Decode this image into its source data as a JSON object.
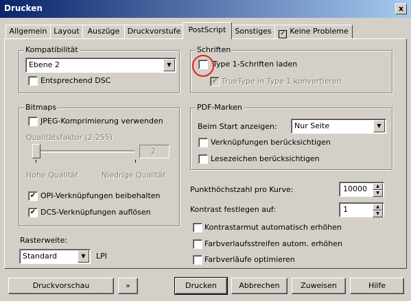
{
  "window": {
    "title": "Drucken",
    "close_label": "x"
  },
  "tabs": [
    {
      "label": "Allgemein"
    },
    {
      "label": "Layout"
    },
    {
      "label": "Auszüge"
    },
    {
      "label": "Druckvorstufe"
    },
    {
      "label": "PostScript",
      "active": true
    },
    {
      "label": "Sonstiges"
    },
    {
      "label": "Keine Probleme"
    }
  ],
  "compat": {
    "legend": "Kompatibilität",
    "level": "Ebene 2",
    "dsc_label": "Entsprechend DSC",
    "dsc_checked": false
  },
  "bitmaps": {
    "legend": "Bitmaps",
    "jpeg_label": "JPEG-Komprimierung verwenden",
    "jpeg_checked": false,
    "quality_label": "Qualitätsfaktor (2-255)",
    "quality_value": "2",
    "high_quality": "Hohe Qualität",
    "low_quality": "Niedrige Qualität",
    "opi_label": "OPI-Verknüpfungen beibehalten",
    "opi_checked": true,
    "dcs_label": "DCS-Verknüpfungen auflösen",
    "dcs_checked": true
  },
  "raster": {
    "label": "Rasterweite:",
    "value": "Standard",
    "unit": "LPI"
  },
  "fonts": {
    "legend": "Schriften",
    "type1_label": "Type 1-Schriften laden",
    "type1_checked": false,
    "truetype_label": "TrueType in Type 1 konvertieren",
    "truetype_checked": true
  },
  "pdf": {
    "legend": "PDF-Marken",
    "start_label": "Beim Start anzeigen:",
    "start_value": "Nur Seite",
    "links_label": "Verknüpfungen berücksichtigen",
    "bookmarks_label": "Lesezeichen berücksichtigen"
  },
  "curve": {
    "label": "Punkthöchstzahl pro Kurve:",
    "value": "10000"
  },
  "contrast": {
    "label": "Kontrast festlegen auf:",
    "value": "1"
  },
  "options": {
    "contrast_auto": "Kontrastarmut automatisch erhöhen",
    "gradient_strips": "Farbverlaufsstreifen autom. erhöhen",
    "gradient_opt": "Farbverläufe optimieren"
  },
  "buttons": {
    "preview": "Druckvorschau",
    "expand": "»",
    "print": "Drucken",
    "cancel": "Abbrechen",
    "assign": "Zuweisen",
    "help": "Hilfe"
  },
  "colors": {
    "titlebar_start": "#0a246a",
    "highlight_circle": "#e02020",
    "face": "#d4d0c8"
  }
}
